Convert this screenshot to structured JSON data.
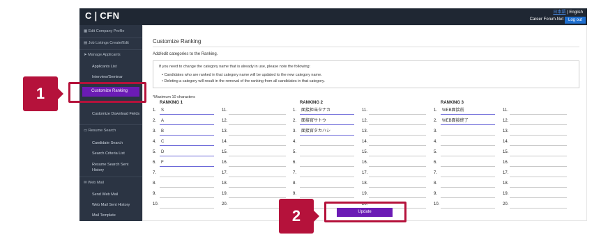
{
  "app": {
    "logo": "C❘CFN",
    "lang_link": "日本語",
    "lang_sep": " | ",
    "lang_current": "English",
    "forum_label": "Career Forum.Net",
    "logout_label": "Log out"
  },
  "sidebar": {
    "items": [
      {
        "label": "Edit Company Profile"
      },
      {
        "label": "Job Listings Create/Edit"
      },
      {
        "label": "Manage Applicants"
      },
      {
        "label": "Applicants List"
      },
      {
        "label": "Interview/Seminar"
      },
      {
        "label": "Customize Ranking"
      },
      {
        "label": "Customize Download Fields"
      },
      {
        "label": "Resume Search"
      },
      {
        "label": "Candidate Search"
      },
      {
        "label": "Search Criteria List"
      },
      {
        "label": "Resume Search Sent History"
      },
      {
        "label": "Web Mail"
      },
      {
        "label": "Send Web Mail"
      },
      {
        "label": "Web Mail Sent History"
      },
      {
        "label": "Mail Template"
      }
    ]
  },
  "main": {
    "title": "Customize Ranking",
    "subtitle": "Add/edit categories to the Ranking.",
    "notice_intro": "If you need to change the category name that is already in use, please note the following:",
    "notice_bullets": [
      "Candidates who are ranked in that category name will be updated to the new category name.",
      "Deleting a category will result in the removal of the ranking from all candidates in that category."
    ],
    "max_chars": "*Maximum 10 characters",
    "rankings": [
      {
        "title": "RANKING 1",
        "values": [
          "S",
          "A",
          "B",
          "C",
          "D",
          "F",
          "",
          "",
          "",
          ""
        ],
        "values_right": [
          "",
          "",
          "",
          "",
          "",
          "",
          "",
          "",
          "",
          ""
        ]
      },
      {
        "title": "RANKING 2",
        "values": [
          "面接担当タナカ",
          "面接官サトウ",
          "面接官タカハシ",
          "",
          "",
          "",
          "",
          "",
          "",
          ""
        ],
        "values_right": [
          "",
          "",
          "",
          "",
          "",
          "",
          "",
          "",
          "",
          ""
        ]
      },
      {
        "title": "RANKING 3",
        "values": [
          "WEB面接前",
          "WEB面接終了",
          "",
          "",
          "",
          "",
          "",
          "",
          "",
          ""
        ],
        "values_right": [
          "",
          "",
          "",
          "",
          "",
          "",
          "",
          "",
          "",
          ""
        ]
      }
    ],
    "numbers_left": [
      "1.",
      "2.",
      "3.",
      "4.",
      "5.",
      "6.",
      "7.",
      "8.",
      "9.",
      "10."
    ],
    "numbers_right": [
      "11.",
      "12.",
      "13.",
      "14.",
      "15.",
      "16.",
      "17.",
      "18.",
      "19.",
      "20."
    ],
    "update_label": "Update"
  },
  "callouts": {
    "badge_1": "1",
    "badge_2": "2",
    "color": "#b5123b"
  },
  "colors": {
    "accent": "#6b1bb5",
    "sidebar_bg": "#2b3443",
    "topbar_bg": "#1f2733"
  }
}
